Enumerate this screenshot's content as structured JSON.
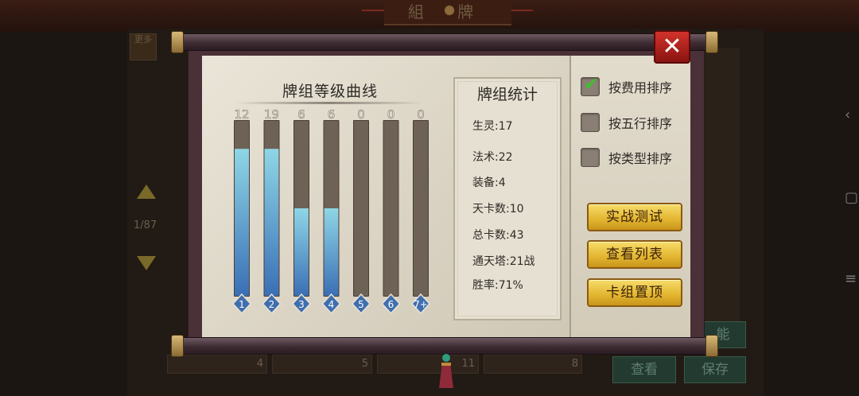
{
  "background": {
    "banner_text": "組 牌",
    "left_tab": "更多",
    "page_indicator": "1/87",
    "slot_counts": [
      "4",
      "5",
      "11",
      "8"
    ],
    "buttons": [
      "查看",
      "保存"
    ],
    "side_label": "能"
  },
  "dialog": {
    "close_label": "✕",
    "chart_title": "牌组等级曲线",
    "stats_title": "牌组统计",
    "stats": [
      "生灵:17",
      "法术:22",
      "装备:4",
      "天卡数:10",
      "总卡数:43",
      "通天塔:21战",
      "胜率:71%"
    ],
    "sort_options": [
      {
        "label": "按费用排序",
        "checked": true
      },
      {
        "label": "按五行排序",
        "checked": false
      },
      {
        "label": "按类型排序",
        "checked": false
      }
    ],
    "action_buttons": [
      "实战测试",
      "查看列表",
      "卡组置顶"
    ]
  },
  "chart_data": {
    "type": "bar",
    "categories": [
      "1",
      "2",
      "3",
      "4",
      "5",
      "6",
      "7+"
    ],
    "values": [
      12,
      19,
      6,
      6,
      0,
      0,
      0
    ],
    "fill_fraction": [
      0.84,
      0.84,
      0.5,
      0.5,
      0,
      0,
      0
    ],
    "title": "牌组等级曲线",
    "colors": {
      "bar_fill_top": "#8fd6e6",
      "bar_fill_bottom": "#3a6fb5",
      "bar_track": "#6e6257",
      "badge": "#3f6fae"
    }
  }
}
